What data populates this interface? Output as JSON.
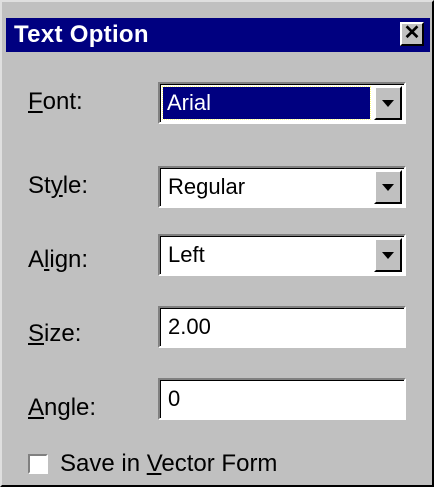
{
  "window": {
    "title": "Text Option"
  },
  "fields": {
    "font": {
      "label_pre": "",
      "label_u": "F",
      "label_post": "ont:",
      "value": "Arial"
    },
    "style": {
      "label_pre": "St",
      "label_u": "y",
      "label_post": "le:",
      "value": "Regular"
    },
    "align": {
      "label_pre": "A",
      "label_u": "l",
      "label_post": "ign:",
      "value": "Left"
    },
    "size": {
      "label_pre": "",
      "label_u": "S",
      "label_post": "ize:",
      "value": "2.00"
    },
    "angle": {
      "label_pre": "",
      "label_u": "A",
      "label_post": "ngle:",
      "value": "0"
    }
  },
  "checkbox": {
    "checked": false,
    "label_pre": "Save in ",
    "label_u": "V",
    "label_post": "ector Form"
  },
  "colors": {
    "titlebar": "#000080",
    "face": "#c0c0c0"
  }
}
